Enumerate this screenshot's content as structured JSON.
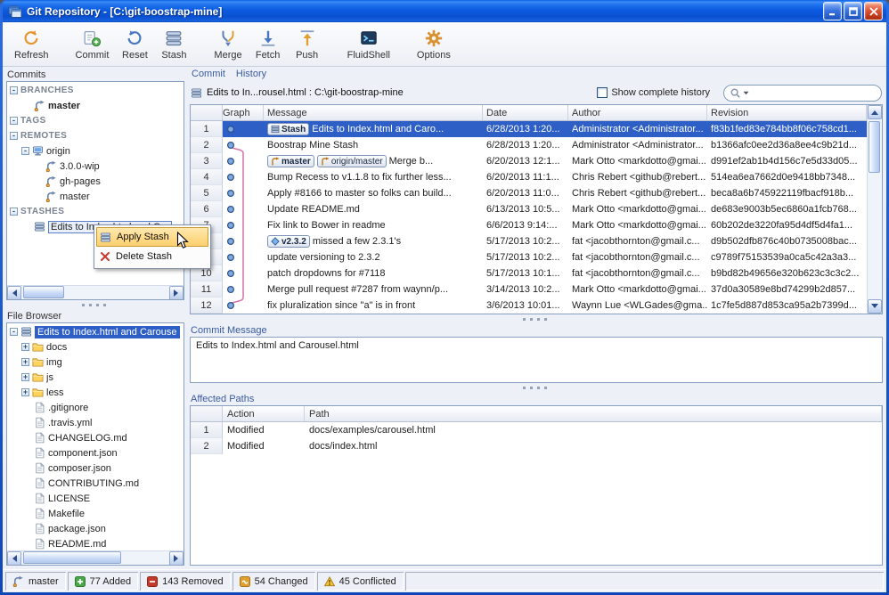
{
  "window": {
    "title": "Git Repository - [C:\\git-boostrap-mine]"
  },
  "toolbar": {
    "items": [
      {
        "label": "Refresh",
        "icon": "refresh-icon"
      },
      {
        "label": "Commit",
        "icon": "commit-icon",
        "group": true
      },
      {
        "label": "Reset",
        "icon": "reset-icon"
      },
      {
        "label": "Stash",
        "icon": "stash-toolbar-icon"
      },
      {
        "label": "Merge",
        "icon": "merge-icon",
        "group": true
      },
      {
        "label": "Fetch",
        "icon": "fetch-icon"
      },
      {
        "label": "Push",
        "icon": "push-icon"
      },
      {
        "label": "FluidShell",
        "icon": "fluidshell-icon",
        "group": true
      },
      {
        "label": "Options",
        "icon": "options-icon",
        "group": true
      }
    ]
  },
  "left": {
    "commits": {
      "title": "Commits",
      "tree": [
        {
          "depth": 0,
          "expander": "-",
          "label": "BRANCHES",
          "section": true
        },
        {
          "depth": 1,
          "icon": "branch-icon",
          "label": "master",
          "bold": true
        },
        {
          "depth": 0,
          "expander": "-",
          "label": "TAGS",
          "section": true
        },
        {
          "depth": 0,
          "expander": "-",
          "label": "REMOTES",
          "section": true
        },
        {
          "depth": 1,
          "expander": "-",
          "icon": "remote-icon",
          "label": "origin"
        },
        {
          "depth": 2,
          "icon": "branch-icon",
          "label": "3.0.0-wip"
        },
        {
          "depth": 2,
          "icon": "branch-icon",
          "label": "gh-pages"
        },
        {
          "depth": 2,
          "icon": "branch-icon",
          "label": "master"
        },
        {
          "depth": 0,
          "expander": "-",
          "label": "STASHES",
          "section": true
        },
        {
          "depth": 1,
          "icon": "stash-icon",
          "label": "Edits to Index.html and Car",
          "focus": true
        }
      ]
    },
    "file_browser": {
      "title": "File Browser",
      "tree": [
        {
          "depth": 0,
          "expander": "-",
          "icon": "stash-icon",
          "label": "Edits to Index.html and Carouse",
          "selected": true
        },
        {
          "depth": 1,
          "expander": "+",
          "icon": "folder-icon",
          "label": "docs"
        },
        {
          "depth": 1,
          "expander": "+",
          "icon": "folder-icon",
          "label": "img"
        },
        {
          "depth": 1,
          "expander": "+",
          "icon": "folder-icon",
          "label": "js"
        },
        {
          "depth": 1,
          "expander": "+",
          "icon": "folder-icon",
          "label": "less"
        },
        {
          "depth": 1,
          "icon": "file-icon",
          "label": ".gitignore"
        },
        {
          "depth": 1,
          "icon": "file-icon",
          "label": ".travis.yml"
        },
        {
          "depth": 1,
          "icon": "file-icon",
          "label": "CHANGELOG.md"
        },
        {
          "depth": 1,
          "icon": "file-icon",
          "label": "component.json"
        },
        {
          "depth": 1,
          "icon": "file-icon",
          "label": "composer.json"
        },
        {
          "depth": 1,
          "icon": "file-icon",
          "label": "CONTRIBUTING.md"
        },
        {
          "depth": 1,
          "icon": "file-icon",
          "label": "LICENSE"
        },
        {
          "depth": 1,
          "icon": "file-icon",
          "label": "Makefile"
        },
        {
          "depth": 1,
          "icon": "file-icon",
          "label": "package.json"
        },
        {
          "depth": 1,
          "icon": "file-icon",
          "label": "README.md"
        }
      ]
    }
  },
  "history": {
    "tabs": [
      {
        "label": "Commit"
      },
      {
        "label": "History"
      }
    ],
    "selection_info": "Edits to In...rousel.html : C:\\git-boostrap-mine",
    "show_complete_label": "Show complete history",
    "show_complete_checked": false,
    "search_placeholder": "",
    "columns": [
      "Graph",
      "Message",
      "Date",
      "Author",
      "Revision"
    ],
    "rows": [
      {
        "num": 1,
        "selected": true,
        "badges": [
          {
            "type": "stash",
            "text": "Stash",
            "icon": "stash-badge-icon",
            "bold": true
          }
        ],
        "message": "Edits to Index.html and Caro...",
        "date": "6/28/2013 1:20...",
        "author": "Administrator <Administrator...",
        "revision": "f83b1fed83e784bb8f06c758cd1...",
        "graph": {
          "dot": 0
        }
      },
      {
        "num": 2,
        "message": "Boostrap Mine Stash",
        "date": "6/28/2013 1:20...",
        "author": "Administrator <Administrator...",
        "revision": "b1366afc0ee2d36a8ee4c9b21d...",
        "graph": {
          "dot": 0,
          "out": 1
        }
      },
      {
        "num": 3,
        "badges": [
          {
            "type": "branch",
            "text": "master",
            "icon": "branch-badge-icon",
            "bold": true
          },
          {
            "type": "branch",
            "text": "origin/master",
            "icon": "branch-badge-icon"
          }
        ],
        "message": "Merge b...",
        "date": "6/20/2013 12:1...",
        "author": "Mark Otto <markdotto@gmai...",
        "revision": "d991ef2ab1b4d156c7e5d33d05...",
        "graph": {
          "dot": 0,
          "through": [
            1
          ]
        }
      },
      {
        "num": 4,
        "message": "Bump Recess to v1.1.8 to fix further less...",
        "date": "6/20/2013 11:1...",
        "author": "Chris Rebert <github@rebert...",
        "revision": "514ea6ea7662d0e9418bb7348...",
        "graph": {
          "dot": 0,
          "through": [
            1
          ]
        }
      },
      {
        "num": 5,
        "message": "Apply #8166 to master so folks can build...",
        "date": "6/20/2013 11:0...",
        "author": "Chris Rebert <github@rebert...",
        "revision": "beca8a6b745922119fbacf918b...",
        "graph": {
          "dot": 0,
          "through": [
            1
          ]
        }
      },
      {
        "num": 6,
        "message": "Update README.md",
        "date": "6/13/2013 10:5...",
        "author": "Mark Otto <markdotto@gmai...",
        "revision": "de683e9003b5ec6860a1fcb768...",
        "graph": {
          "dot": 0,
          "through": [
            1
          ]
        }
      },
      {
        "num": 7,
        "message": "Fix link to Bower in readme",
        "date": "6/6/2013 9:14:...",
        "author": "Mark Otto <markdotto@gmai...",
        "revision": "60b202de3220fa95d4df5d4fa1...",
        "graph": {
          "dot": 0,
          "through": [
            1
          ]
        }
      },
      {
        "num": 8,
        "badges": [
          {
            "type": "tag",
            "text": "v2.3.2",
            "icon": "tag-badge-icon",
            "bold": true
          }
        ],
        "message": "missed a few 2.3.1's",
        "date": "5/17/2013 10:2...",
        "author": "fat <jacobthornton@gmail.c...",
        "revision": "d9b502dfb876c40b0735008bac...",
        "graph": {
          "dot": 0,
          "through": [
            1
          ]
        }
      },
      {
        "num": 9,
        "message": "update versioning to 2.3.2",
        "date": "5/17/2013 10:2...",
        "author": "fat <jacobthornton@gmail.c...",
        "revision": "c9789f75153539a0ca5c42a3a3...",
        "graph": {
          "dot": 0,
          "through": [
            1
          ]
        }
      },
      {
        "num": 10,
        "message": "patch dropdowns for #7118",
        "date": "5/17/2013 10:1...",
        "author": "fat <jacobthornton@gmail.c...",
        "revision": "b9bd82b49656e320b623c3c3c2...",
        "graph": {
          "dot": 0,
          "through": [
            1
          ]
        }
      },
      {
        "num": 11,
        "message": "Merge pull request #7287 from waynn/p...",
        "date": "3/14/2013 10:2...",
        "author": "Mark Otto <markdotto@gmai...",
        "revision": "37d0a30589e8bd74299b2d857...",
        "graph": {
          "dot": 0,
          "through": [
            1
          ]
        }
      },
      {
        "num": 12,
        "message": "fix pluralization since \"a\" is in front",
        "date": "3/6/2013 10:01...",
        "author": "Waynn Lue <WLGades@gma...",
        "revision": "1c7fe5d887d853ca95a2b7399d...",
        "graph": {
          "dot": 0,
          "in": 1
        }
      }
    ]
  },
  "commit_message": {
    "title": "Commit Message",
    "text": "Edits to Index.html and Carousel.html"
  },
  "affected_paths": {
    "title": "Affected Paths",
    "columns": [
      "Action",
      "Path"
    ],
    "rows": [
      {
        "num": 1,
        "action": "Modified",
        "path": "docs/examples/carousel.html"
      },
      {
        "num": 2,
        "action": "Modified",
        "path": "docs/index.html"
      }
    ]
  },
  "status_bar": {
    "items": [
      {
        "icon": "branch-icon",
        "label": "master"
      },
      {
        "icon": "added-icon",
        "label": "77 Added"
      },
      {
        "icon": "removed-icon",
        "label": "143 Removed"
      },
      {
        "icon": "changed-icon",
        "label": "54 Changed"
      },
      {
        "icon": "conflicted-icon",
        "label": "45 Conflicted"
      }
    ]
  },
  "context_menu": {
    "items": [
      {
        "icon": "apply-stash-icon",
        "label": "Apply Stash",
        "highlighted": true
      },
      {
        "icon": "delete-stash-icon",
        "label": "Delete Stash",
        "highlighted": false
      }
    ]
  },
  "colors": {
    "selection": "#2E5FC6",
    "menu_highlight": "#FDCF6E",
    "graph_line": "#D878AC",
    "graph_dot": "#7FA8DC",
    "added": "#4CA64C",
    "removed": "#C23A2A",
    "changed": "#E0A030",
    "conflicted": "#F4C63A",
    "header_blue": "#3A5BA0"
  }
}
